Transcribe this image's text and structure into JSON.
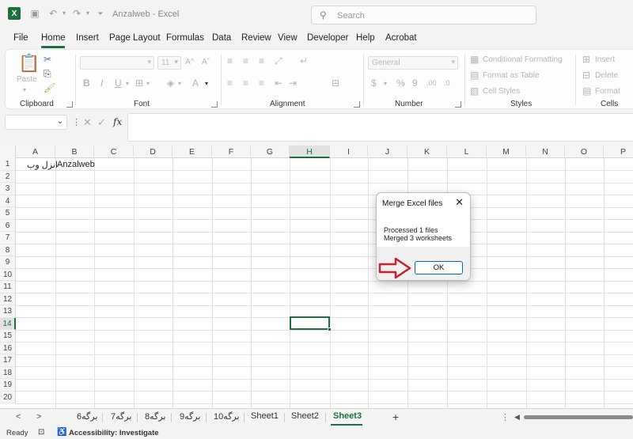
{
  "titlebar": {
    "doc_title": "Anzalweb  -  Excel",
    "search_placeholder": "Search"
  },
  "menu": [
    "File",
    "Home",
    "Insert",
    "Page Layout",
    "Formulas",
    "Data",
    "Review",
    "View",
    "Developer",
    "Help",
    "Acrobat"
  ],
  "ribbon": {
    "clipboard": {
      "label": "Clipboard",
      "paste": "Paste"
    },
    "font": {
      "label": "Font",
      "size": "11"
    },
    "alignment": {
      "label": "Alignment"
    },
    "number": {
      "label": "Number",
      "format": "General"
    },
    "styles": {
      "label": "Styles",
      "conditional_formatting": "Conditional Formatting",
      "format_as_table": "Format as Table",
      "cell_styles": "Cell Styles"
    },
    "cells": {
      "label": "Cells",
      "insert": "Insert",
      "delete": "Delete",
      "format": "Format"
    }
  },
  "formula_bar": {
    "fx": "fx"
  },
  "grid": {
    "columns": [
      "A",
      "B",
      "C",
      "D",
      "E",
      "F",
      "G",
      "H",
      "I",
      "J",
      "K",
      "L",
      "M",
      "N",
      "O",
      "P"
    ],
    "rows": [
      "1",
      "2",
      "3",
      "4",
      "5",
      "6",
      "7",
      "8",
      "9",
      "10",
      "11",
      "12",
      "13",
      "14",
      "15",
      "16",
      "17",
      "18",
      "19",
      "20"
    ],
    "selected_column": "H",
    "selected_row": "14",
    "cells": {
      "A1": "انزل وب",
      "B1": "Anzalweb"
    }
  },
  "sheet_tabs": [
    "برگه6",
    "برگه7",
    "برگه8",
    "برگه9",
    "برگه10",
    "Sheet1",
    "Sheet2",
    "Sheet3"
  ],
  "active_sheet": "Sheet3",
  "status": {
    "ready": "Ready",
    "accessibility": "Accessibility: Investigate"
  },
  "dialog": {
    "title": "Merge Excel files",
    "line1": "Processed 1 files",
    "line2": "Merged 3 worksheets",
    "ok": "OK"
  },
  "colors": {
    "excel_green": "#1d6f42",
    "annotation_red": "#c8202a",
    "ok_border": "#0067c0"
  }
}
